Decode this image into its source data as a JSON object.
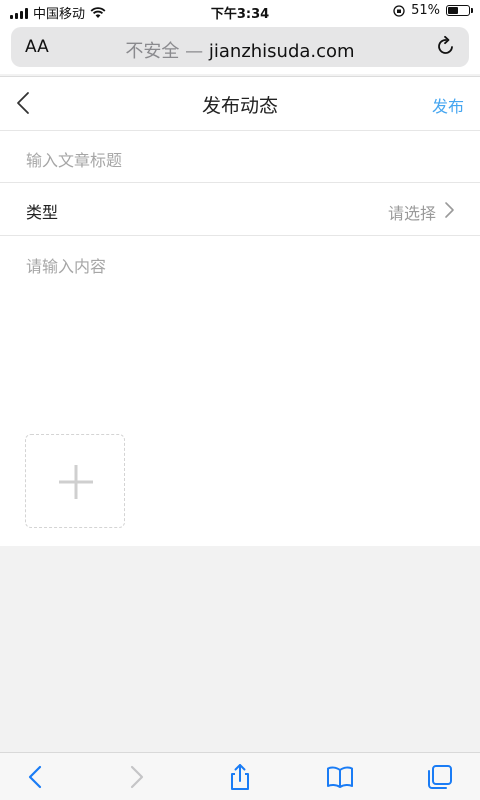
{
  "status_bar": {
    "carrier": "中国移动",
    "time": "下午3:34",
    "battery_percent": "51%",
    "battery_level": 0.51
  },
  "address_bar": {
    "text_size_label": "AA",
    "insecure_label": "不安全 —",
    "domain": "jianzhisuda.com"
  },
  "nav": {
    "title": "发布动态",
    "publish_label": "发布"
  },
  "form": {
    "title_placeholder": "输入文章标题",
    "type_label": "类型",
    "type_value": "请选择",
    "content_placeholder": "请输入内容"
  },
  "icons": {
    "back": "chevron-left-icon",
    "chevron": "chevron-right-icon",
    "upload": "plus-icon",
    "reload": "reload-icon",
    "share": "share-icon",
    "bookmarks": "book-icon",
    "tabs": "tabs-icon"
  },
  "colors": {
    "accent": "#46a6f0",
    "placeholder": "#a6a6a6",
    "browser_blue": "#1a7cf5"
  }
}
